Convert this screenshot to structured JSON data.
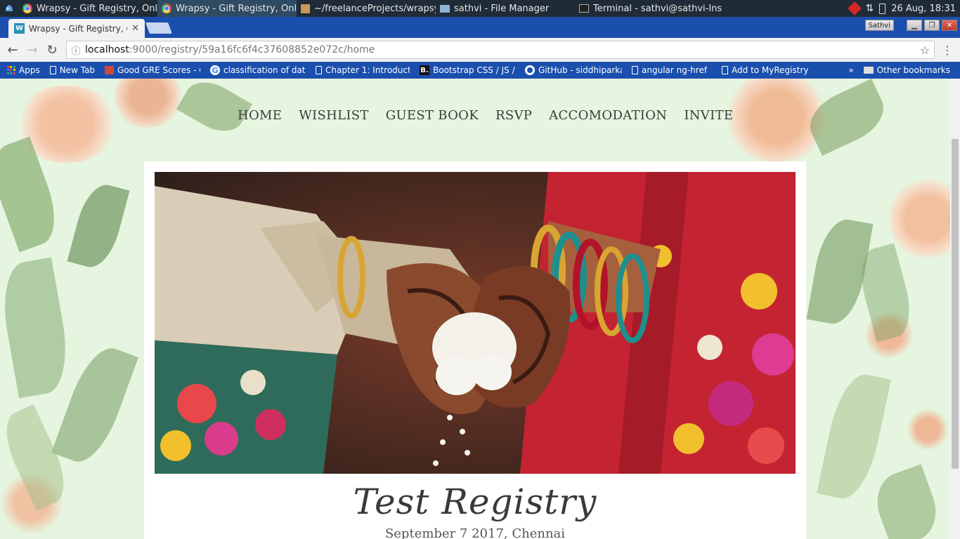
{
  "taskbar": {
    "tasks": [
      {
        "label": "Wrapsy - Gift Registry, Onlin...",
        "active": false
      },
      {
        "label": "Wrapsy - Gift Registry, Onlin...",
        "active": true
      },
      {
        "label": "~/freelanceProjects/wrapsy/...",
        "active": false
      },
      {
        "label": "sathvi - File Manager",
        "active": false
      },
      {
        "label": "Terminal - sathvi@sathvi-Ins...",
        "active": false
      }
    ],
    "clock": "26 Aug, 18:31"
  },
  "browser": {
    "tab_title": "Wrapsy - Gift Registry, C",
    "profile_name": "Sathvi",
    "url_host": "localhost",
    "url_path": ":9000/registry/59a16fc6f4c37608852e072c/home"
  },
  "bookmarks": {
    "items": [
      "Apps",
      "New Tab",
      "Good GRE Scores - G",
      "classification of data",
      "Chapter 1: Introduct",
      "Bootstrap CSS / JS / I",
      "GitHub - siddhiparka",
      "angular ng-href",
      "Add to MyRegistry"
    ],
    "overflow": "»",
    "other": "Other bookmarks"
  },
  "site": {
    "nav": [
      "HOME",
      "WISHLIST",
      "GUEST BOOK",
      "RSVP",
      "ACCOMODATION",
      "INVITE"
    ],
    "registry_title": "Test Registry",
    "registry_subtitle": "September 7 2017, Chennai"
  },
  "colors": {
    "page_bg": "#e6f5df",
    "browser_blue": "#1b4fae",
    "nav_text": "#3b3b3b"
  }
}
